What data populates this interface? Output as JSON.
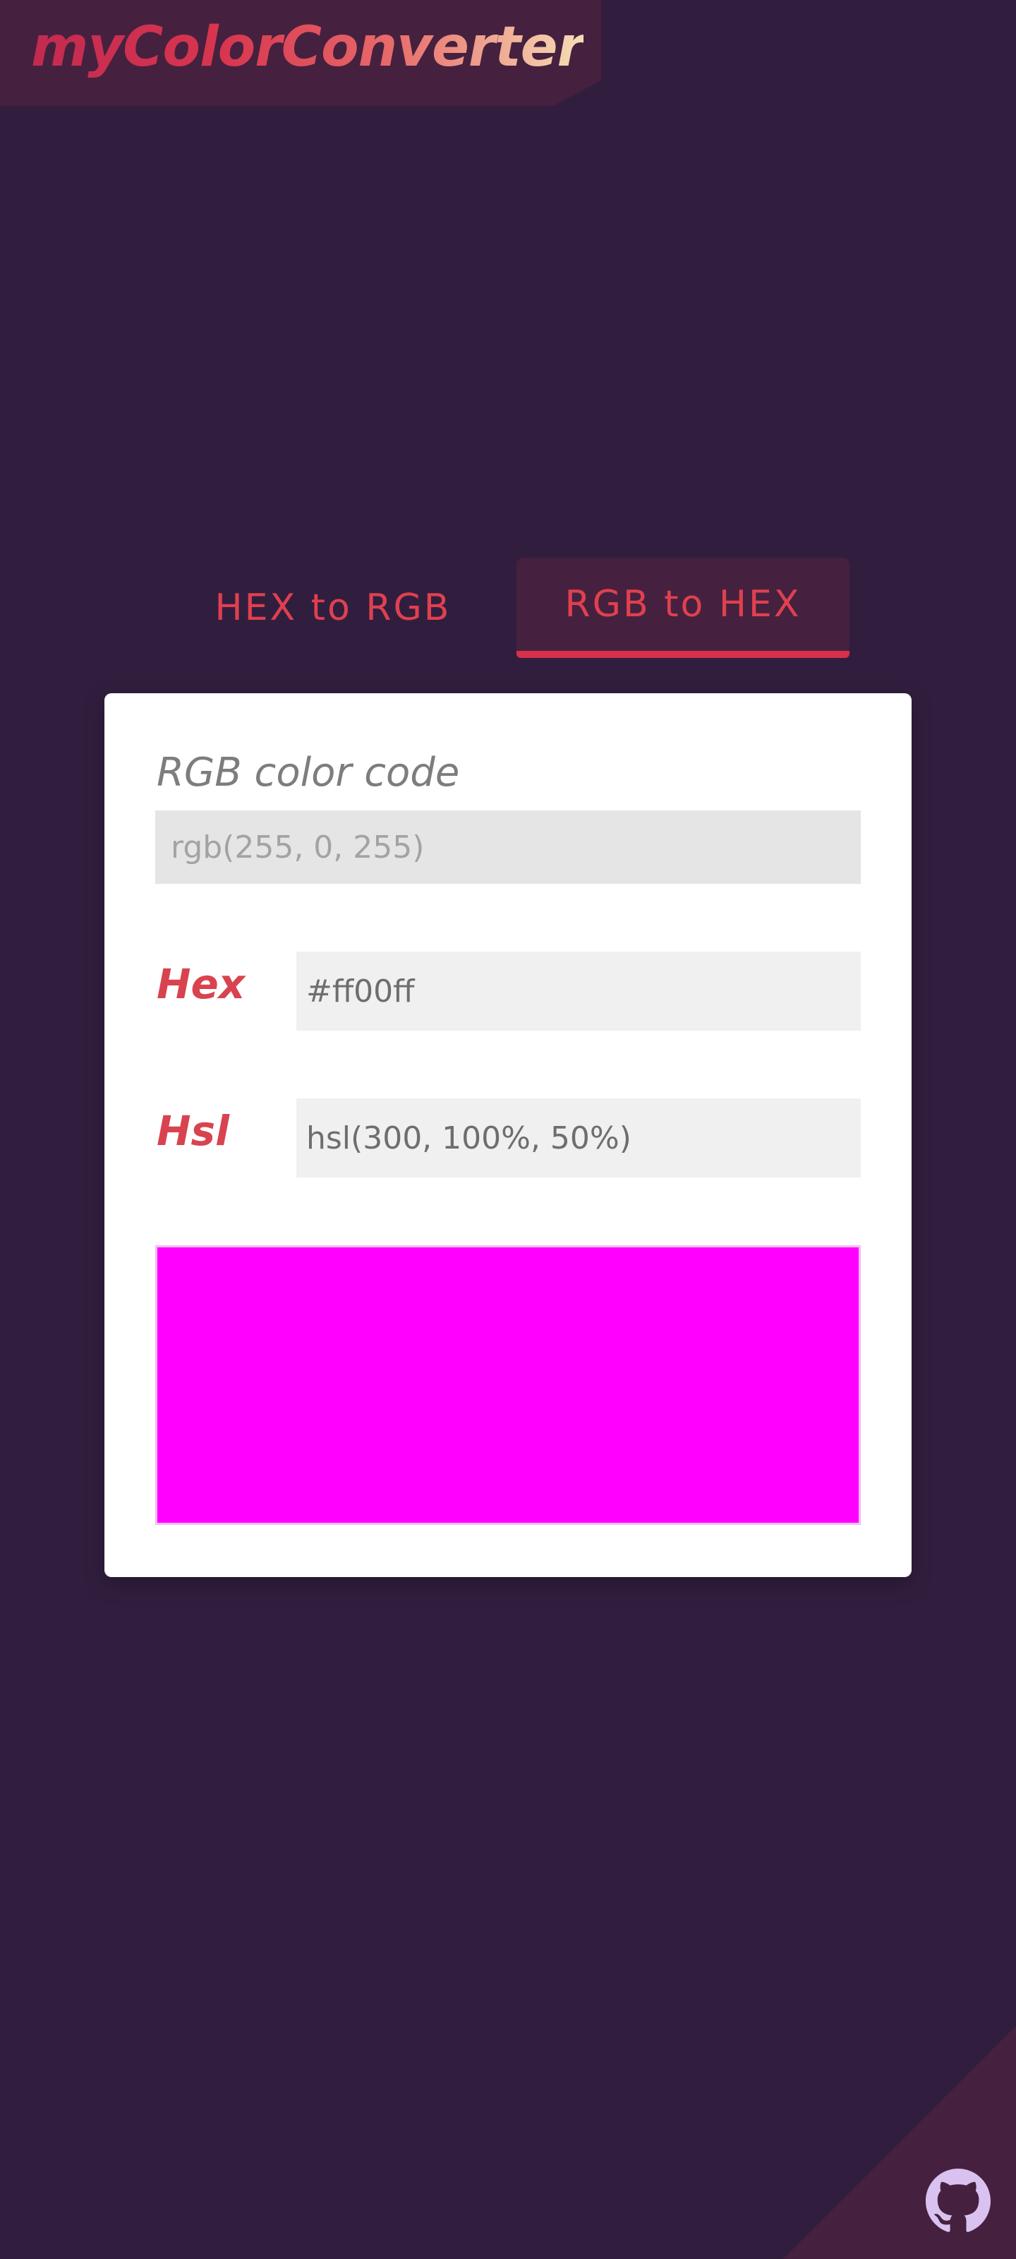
{
  "header": {
    "logo_text": "myColorConverter"
  },
  "tabs": [
    {
      "label": "HEX to RGB",
      "active": false
    },
    {
      "label": "RGB to HEX",
      "active": true
    }
  ],
  "converter": {
    "title": "RGB color code",
    "rgb_input": {
      "value": "",
      "placeholder": "rgb(255, 0, 255)"
    },
    "hex": {
      "label": "Hex",
      "value": "#ff00ff"
    },
    "hsl": {
      "label": "Hsl",
      "value": "hsl(300, 100%, 50%)"
    },
    "preview_color": "#ff00ff"
  },
  "colors": {
    "background": "#311e3e",
    "panel": "#45213f",
    "accent": "#e0404f",
    "github_icon": "#d9c2ef"
  },
  "footer": {
    "icon": "github-icon"
  }
}
